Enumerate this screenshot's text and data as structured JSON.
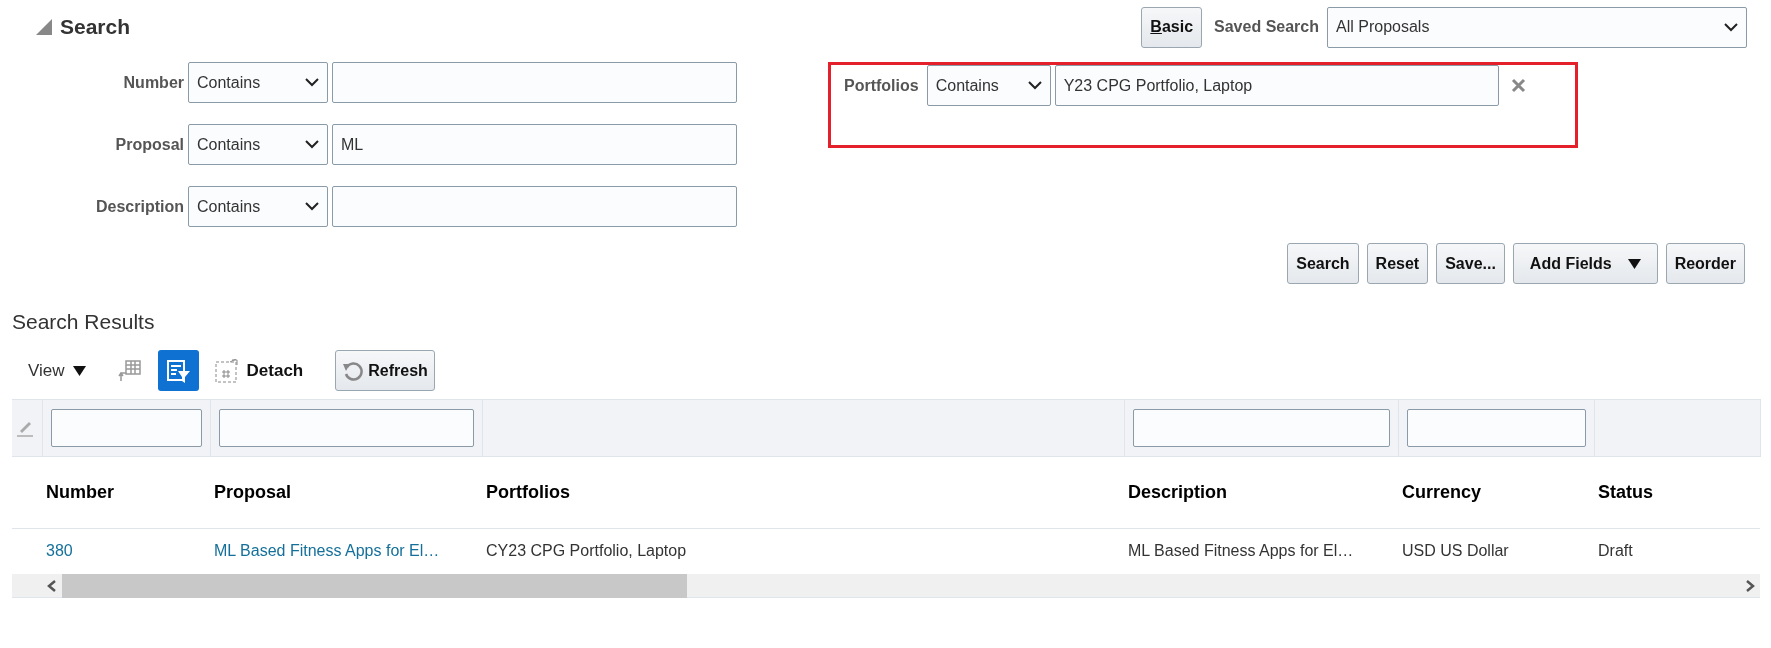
{
  "search": {
    "title": "Search",
    "expanded": true,
    "mode_button": "Basic",
    "saved_search": {
      "label": "Saved Search",
      "value": "All Proposals"
    },
    "fields": [
      {
        "label": "Number",
        "operator": "Contains"
      },
      {
        "label": "Proposal",
        "operator": "Contains",
        "value": "ML"
      },
      {
        "label": "Description",
        "operator": "Contains"
      }
    ],
    "added_fields": [
      {
        "label": "Portfolios",
        "operator": "Contains",
        "value": "Y23 CPG Portfolio, Laptop",
        "highlighted": true
      }
    ],
    "actions": [
      {
        "label": "Search",
        "kind": "button"
      },
      {
        "label": "Reset",
        "kind": "button"
      },
      {
        "label": "Save...",
        "kind": "button"
      },
      {
        "label": "Add Fields",
        "kind": "menu"
      },
      {
        "label": "Reorder",
        "kind": "button"
      }
    ]
  },
  "results": {
    "title": "Search Results",
    "toolbar": {
      "view": "View",
      "detach": "Detach",
      "refresh": "Refresh",
      "query_by_example_on": true
    },
    "table": {
      "columns": [
        {
          "name": "Number",
          "filterable": true
        },
        {
          "name": "Proposal",
          "filterable": true
        },
        {
          "name": "Portfolios",
          "filterable": false
        },
        {
          "name": "Description",
          "filterable": true
        },
        {
          "name": "Currency",
          "filterable": true
        },
        {
          "name": "Status",
          "filterable": false
        }
      ],
      "rows": [
        {
          "cells": [
            {
              "text": "380",
              "kind": "link"
            },
            {
              "text": "ML Based Fitness Apps for El…",
              "kind": "link"
            },
            {
              "text": "CY23 CPG Portfolio, Laptop",
              "kind": "text"
            },
            {
              "text": "ML Based Fitness Apps for El…",
              "kind": "text"
            },
            {
              "text": "USD US Dollar",
              "kind": "text"
            },
            {
              "text": "Draft",
              "kind": "text"
            }
          ]
        }
      ]
    }
  }
}
